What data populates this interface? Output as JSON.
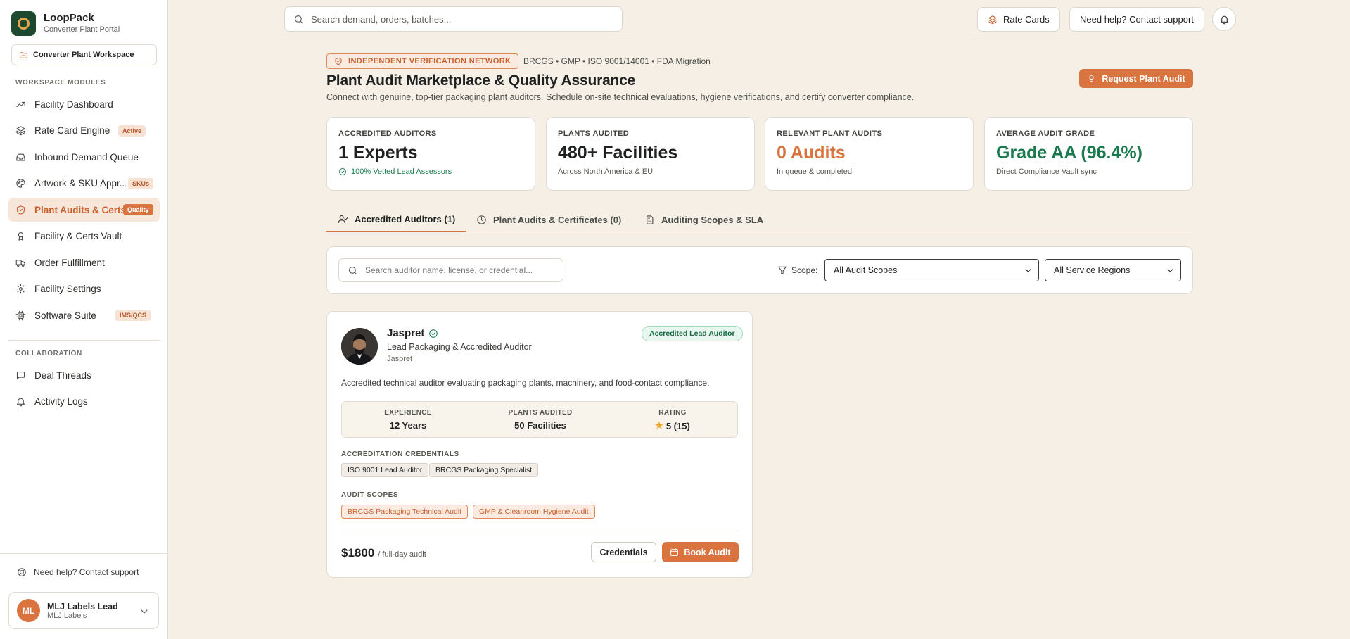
{
  "brand": {
    "name": "LoopPack",
    "subtitle": "Converter Plant Portal"
  },
  "workspace": {
    "label": "Converter Plant Workspace"
  },
  "sidebar": {
    "modules_label": "WORKSPACE MODULES",
    "modules": [
      {
        "label": "Facility Dashboard",
        "icon": "trending-up-icon"
      },
      {
        "label": "Rate Card Engine",
        "icon": "layers-icon",
        "badge": "Active"
      },
      {
        "label": "Inbound Demand Queue",
        "icon": "inbox-icon"
      },
      {
        "label": "Artwork & SKU Appr...",
        "icon": "palette-icon",
        "badge": "SKUs"
      },
      {
        "label": "Plant Audits & Certs",
        "icon": "shield-icon",
        "badge": "Quality",
        "active": true
      },
      {
        "label": "Facility & Certs Vault",
        "icon": "award-icon"
      },
      {
        "label": "Order Fulfillment",
        "icon": "truck-icon"
      },
      {
        "label": "Facility Settings",
        "icon": "gear-icon"
      },
      {
        "label": "Software Suite",
        "icon": "cpu-icon",
        "badge": "IMS/QCS"
      }
    ],
    "collab_label": "COLLABORATION",
    "collab": [
      {
        "label": "Deal Threads",
        "icon": "message-icon"
      },
      {
        "label": "Activity Logs",
        "icon": "bell-icon"
      }
    ],
    "help": "Need help? Contact support",
    "user": {
      "initials": "ML",
      "name": "MLJ Labels Lead",
      "org": "MLJ Labels"
    }
  },
  "topbar": {
    "search_placeholder": "Search demand, orders, batches...",
    "rate_cards": "Rate Cards",
    "help": "Need help? Contact support"
  },
  "header": {
    "badge": "INDEPENDENT VERIFICATION NETWORK",
    "tags": "BRCGS • GMP • ISO 9001/14001 • FDA Migration",
    "title": "Plant Audit Marketplace & Quality Assurance",
    "description": "Connect with genuine, top-tier packaging plant auditors. Schedule on-site technical evaluations, hygiene verifications, and certify converter compliance.",
    "request_button": "Request Plant Audit"
  },
  "stats": [
    {
      "label": "ACCREDITED AUDITORS",
      "value": "1 Experts",
      "sub": "100% Vetted Lead Assessors",
      "tone": "default",
      "sub_tone": "green"
    },
    {
      "label": "PLANTS AUDITED",
      "value": "480+ Facilities",
      "sub": "Across North America & EU",
      "tone": "default",
      "sub_tone": "default"
    },
    {
      "label": "RELEVANT PLANT AUDITS",
      "value": "0 Audits",
      "sub": "In queue & completed",
      "tone": "orange",
      "sub_tone": "default"
    },
    {
      "label": "AVERAGE AUDIT GRADE",
      "value": "Grade AA (96.4%)",
      "sub": "Direct Compliance Vault sync",
      "tone": "green",
      "sub_tone": "default"
    }
  ],
  "tabs": [
    {
      "label": "Accredited Auditors (1)",
      "icon": "user-check-icon",
      "active": true
    },
    {
      "label": "Plant Audits & Certificates (0)",
      "icon": "clock-icon"
    },
    {
      "label": "Auditing Scopes & SLA",
      "icon": "document-icon"
    }
  ],
  "filters": {
    "search_placeholder": "Search auditor name, license, or credential...",
    "scope_label": "Scope:",
    "scope_value": "All Audit Scopes",
    "region_value": "All Service Regions"
  },
  "auditor": {
    "name": "Jaspret",
    "role": "Lead Packaging & Accredited Auditor",
    "handle": "Jaspret",
    "badge": "Accredited Lead Auditor",
    "description": "Accredited technical auditor evaluating packaging plants, machinery, and food-contact compliance.",
    "metrics": [
      {
        "label": "EXPERIENCE",
        "value": "12 Years"
      },
      {
        "label": "PLANTS AUDITED",
        "value": "50 Facilities"
      },
      {
        "label": "RATING",
        "value": "5 (15)",
        "rating": 5
      }
    ],
    "credentials_label": "ACCREDITATION CREDENTIALS",
    "credentials": [
      "ISO 9001 Lead Auditor",
      "BRCGS Packaging Specialist"
    ],
    "scopes_label": "AUDIT SCOPES",
    "scopes": [
      "BRCGS Packaging Technical Audit",
      "GMP & Cleanroom Hygiene Audit"
    ],
    "price": "$1800",
    "price_unit": "/ full-day audit",
    "credentials_button": "Credentials",
    "book_button": "Book Audit"
  },
  "colors": {
    "accent": "#d9733f",
    "success": "#1b7a4d",
    "background": "#f5efe6",
    "brand_dark": "#1d4a2e"
  }
}
